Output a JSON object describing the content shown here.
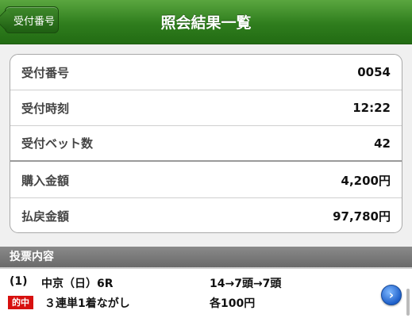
{
  "header": {
    "back_label": "受付番号",
    "title": "照会結果一覧"
  },
  "summary": [
    {
      "label": "受付番号",
      "value": "0054"
    },
    {
      "label": "受付時刻",
      "value": "12:22"
    },
    {
      "label": "受付ベット数",
      "value": "42"
    },
    {
      "label": "購入金額",
      "value": "4,200円"
    },
    {
      "label": "払戻金額",
      "value": "97,780円"
    }
  ],
  "section": {
    "title": "投票内容"
  },
  "bet": {
    "index": "(1)",
    "race": "中京（日）6R",
    "combination": "14→7頭→7頭",
    "hit_badge": "的中",
    "type": "３連単1着ながし",
    "amount": "各100円"
  },
  "colors": {
    "header_green": "#2f7d1d",
    "hit_red": "#d7100f",
    "detail_blue": "#1e5fc9"
  },
  "icons": {
    "back": "back-arrow-icon",
    "detail": "chevron-right-circle-icon"
  }
}
